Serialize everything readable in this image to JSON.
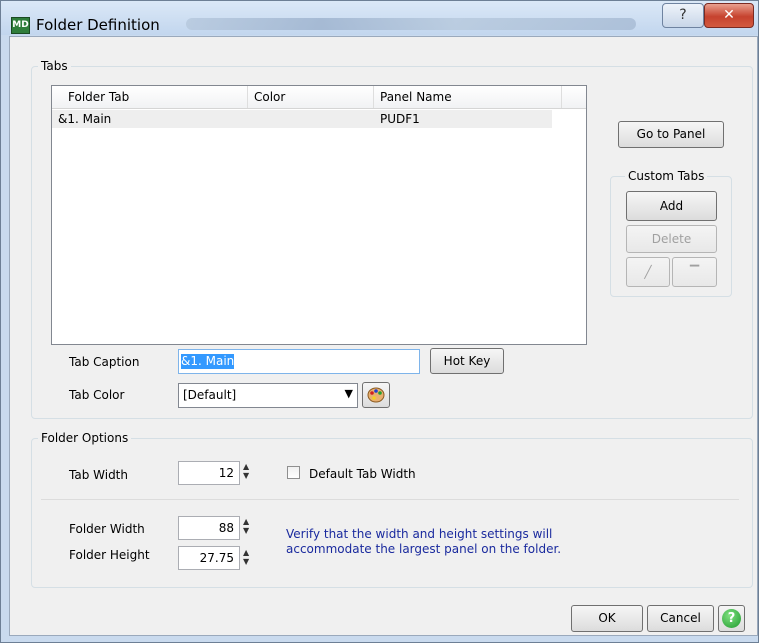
{
  "window": {
    "title": "Folder Definition",
    "app_icon": "MD"
  },
  "tabs_group": {
    "legend": "Tabs",
    "columns": [
      "Folder Tab",
      "Color",
      "Panel Name"
    ],
    "rows": [
      {
        "folder_tab": "&1. Main",
        "color": "",
        "panel_name": "PUDF1"
      }
    ],
    "goto_panel_label": "Go to Panel",
    "custom_tabs_legend": "Custom Tabs",
    "add_label": "Add",
    "delete_label": "Delete",
    "tab_caption_label": "Tab Caption",
    "tab_caption_value": "&1. Main",
    "hot_key_label": "Hot Key",
    "tab_color_label": "Tab Color",
    "tab_color_value": "[Default]"
  },
  "folder_options": {
    "legend": "Folder Options",
    "tab_width_label": "Tab Width",
    "tab_width_value": "12",
    "default_tab_width_label": "Default Tab Width",
    "folder_width_label": "Folder Width",
    "folder_width_value": "88",
    "folder_height_label": "Folder Height",
    "folder_height_value": "27.75",
    "note_line1": "Verify that the width and height settings will",
    "note_line2": "accommodate the largest panel on the folder."
  },
  "footer": {
    "ok_label": "OK",
    "cancel_label": "Cancel",
    "help_icon": "?"
  }
}
